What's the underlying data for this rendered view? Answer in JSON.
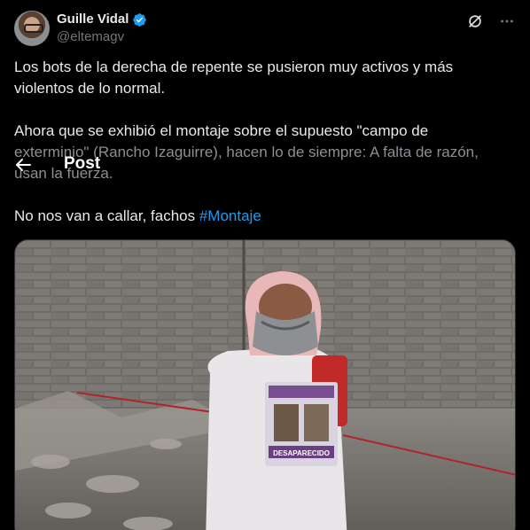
{
  "author": {
    "display_name": "Guille Vidal",
    "handle": "@eltemagv"
  },
  "tweet": {
    "paragraph1": "Los bots de la derecha de repente se pusieron muy activos y más violentos de lo normal.",
    "paragraph2_line1": "Ahora que se exhibió el montaje sobre el supuesto \"campo de",
    "paragraph2_line2": "exterminio\" (Rancho Izaguirre), hacen lo de siempre: A falta de razón,",
    "paragraph2_line3": "usan la fuerza.",
    "paragraph3_text": "No nos van a callar, fachos ",
    "hashtag": "#Montaje"
  },
  "overlay": {
    "title": "Post"
  },
  "icons": {
    "verified": "verified-badge-icon",
    "grok": "grok-icon",
    "more": "more-icon",
    "back": "back-arrow-icon"
  },
  "colors": {
    "background": "#000000",
    "text": "#e7e9ea",
    "secondary_text": "#71767b",
    "link": "#1d9bf0",
    "verified": "#1d9bf0"
  },
  "media": {
    "shirt_text": "DESAPARECIDO"
  }
}
